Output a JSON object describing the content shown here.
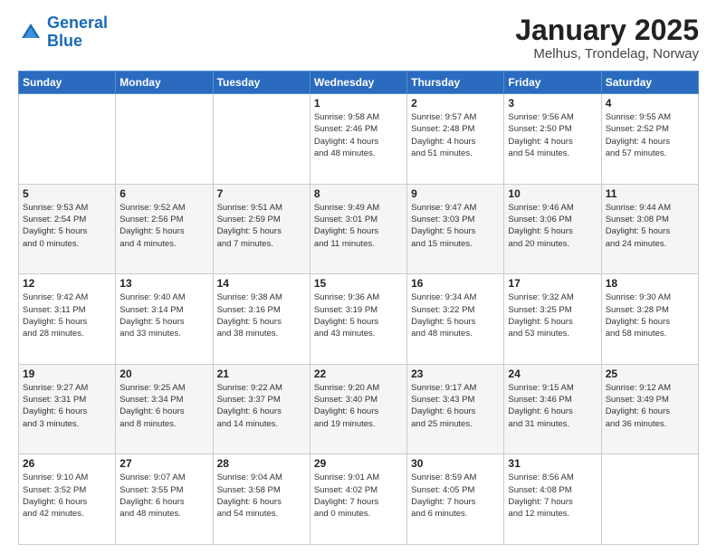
{
  "logo": {
    "line1": "General",
    "line2": "Blue"
  },
  "title": "January 2025",
  "location": "Melhus, Trondelag, Norway",
  "weekdays": [
    "Sunday",
    "Monday",
    "Tuesday",
    "Wednesday",
    "Thursday",
    "Friday",
    "Saturday"
  ],
  "weeks": [
    [
      {
        "day": "",
        "info": ""
      },
      {
        "day": "",
        "info": ""
      },
      {
        "day": "",
        "info": ""
      },
      {
        "day": "1",
        "info": "Sunrise: 9:58 AM\nSunset: 2:46 PM\nDaylight: 4 hours\nand 48 minutes."
      },
      {
        "day": "2",
        "info": "Sunrise: 9:57 AM\nSunset: 2:48 PM\nDaylight: 4 hours\nand 51 minutes."
      },
      {
        "day": "3",
        "info": "Sunrise: 9:56 AM\nSunset: 2:50 PM\nDaylight: 4 hours\nand 54 minutes."
      },
      {
        "day": "4",
        "info": "Sunrise: 9:55 AM\nSunset: 2:52 PM\nDaylight: 4 hours\nand 57 minutes."
      }
    ],
    [
      {
        "day": "5",
        "info": "Sunrise: 9:53 AM\nSunset: 2:54 PM\nDaylight: 5 hours\nand 0 minutes."
      },
      {
        "day": "6",
        "info": "Sunrise: 9:52 AM\nSunset: 2:56 PM\nDaylight: 5 hours\nand 4 minutes."
      },
      {
        "day": "7",
        "info": "Sunrise: 9:51 AM\nSunset: 2:59 PM\nDaylight: 5 hours\nand 7 minutes."
      },
      {
        "day": "8",
        "info": "Sunrise: 9:49 AM\nSunset: 3:01 PM\nDaylight: 5 hours\nand 11 minutes."
      },
      {
        "day": "9",
        "info": "Sunrise: 9:47 AM\nSunset: 3:03 PM\nDaylight: 5 hours\nand 15 minutes."
      },
      {
        "day": "10",
        "info": "Sunrise: 9:46 AM\nSunset: 3:06 PM\nDaylight: 5 hours\nand 20 minutes."
      },
      {
        "day": "11",
        "info": "Sunrise: 9:44 AM\nSunset: 3:08 PM\nDaylight: 5 hours\nand 24 minutes."
      }
    ],
    [
      {
        "day": "12",
        "info": "Sunrise: 9:42 AM\nSunset: 3:11 PM\nDaylight: 5 hours\nand 28 minutes."
      },
      {
        "day": "13",
        "info": "Sunrise: 9:40 AM\nSunset: 3:14 PM\nDaylight: 5 hours\nand 33 minutes."
      },
      {
        "day": "14",
        "info": "Sunrise: 9:38 AM\nSunset: 3:16 PM\nDaylight: 5 hours\nand 38 minutes."
      },
      {
        "day": "15",
        "info": "Sunrise: 9:36 AM\nSunset: 3:19 PM\nDaylight: 5 hours\nand 43 minutes."
      },
      {
        "day": "16",
        "info": "Sunrise: 9:34 AM\nSunset: 3:22 PM\nDaylight: 5 hours\nand 48 minutes."
      },
      {
        "day": "17",
        "info": "Sunrise: 9:32 AM\nSunset: 3:25 PM\nDaylight: 5 hours\nand 53 minutes."
      },
      {
        "day": "18",
        "info": "Sunrise: 9:30 AM\nSunset: 3:28 PM\nDaylight: 5 hours\nand 58 minutes."
      }
    ],
    [
      {
        "day": "19",
        "info": "Sunrise: 9:27 AM\nSunset: 3:31 PM\nDaylight: 6 hours\nand 3 minutes."
      },
      {
        "day": "20",
        "info": "Sunrise: 9:25 AM\nSunset: 3:34 PM\nDaylight: 6 hours\nand 8 minutes."
      },
      {
        "day": "21",
        "info": "Sunrise: 9:22 AM\nSunset: 3:37 PM\nDaylight: 6 hours\nand 14 minutes."
      },
      {
        "day": "22",
        "info": "Sunrise: 9:20 AM\nSunset: 3:40 PM\nDaylight: 6 hours\nand 19 minutes."
      },
      {
        "day": "23",
        "info": "Sunrise: 9:17 AM\nSunset: 3:43 PM\nDaylight: 6 hours\nand 25 minutes."
      },
      {
        "day": "24",
        "info": "Sunrise: 9:15 AM\nSunset: 3:46 PM\nDaylight: 6 hours\nand 31 minutes."
      },
      {
        "day": "25",
        "info": "Sunrise: 9:12 AM\nSunset: 3:49 PM\nDaylight: 6 hours\nand 36 minutes."
      }
    ],
    [
      {
        "day": "26",
        "info": "Sunrise: 9:10 AM\nSunset: 3:52 PM\nDaylight: 6 hours\nand 42 minutes."
      },
      {
        "day": "27",
        "info": "Sunrise: 9:07 AM\nSunset: 3:55 PM\nDaylight: 6 hours\nand 48 minutes."
      },
      {
        "day": "28",
        "info": "Sunrise: 9:04 AM\nSunset: 3:58 PM\nDaylight: 6 hours\nand 54 minutes."
      },
      {
        "day": "29",
        "info": "Sunrise: 9:01 AM\nSunset: 4:02 PM\nDaylight: 7 hours\nand 0 minutes."
      },
      {
        "day": "30",
        "info": "Sunrise: 8:59 AM\nSunset: 4:05 PM\nDaylight: 7 hours\nand 6 minutes."
      },
      {
        "day": "31",
        "info": "Sunrise: 8:56 AM\nSunset: 4:08 PM\nDaylight: 7 hours\nand 12 minutes."
      },
      {
        "day": "",
        "info": ""
      }
    ]
  ]
}
